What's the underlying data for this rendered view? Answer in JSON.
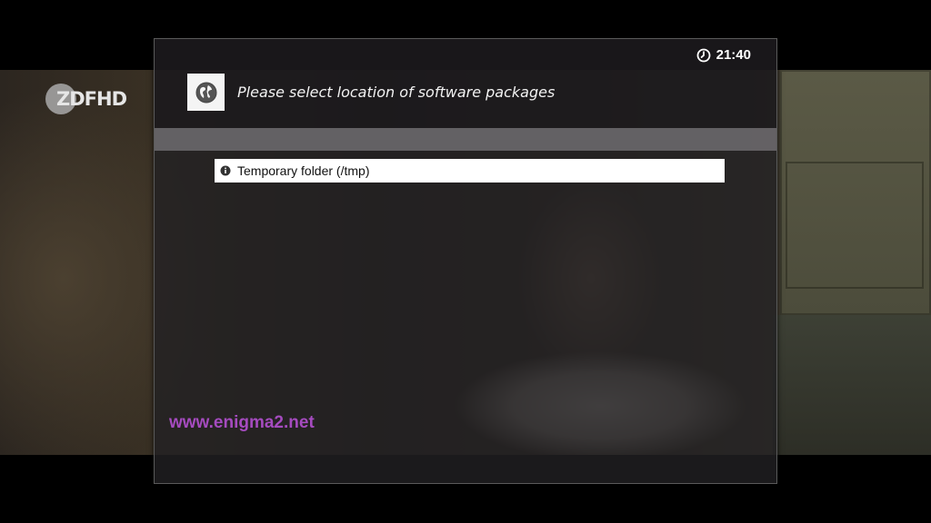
{
  "channel_logo": {
    "text": "ZDFHD"
  },
  "clock": {
    "time": "21:40"
  },
  "dialog": {
    "title": "Please select location of software packages",
    "app_icon": "globe-icon",
    "list": {
      "items": [
        {
          "label": "Temporary folder (/tmp)",
          "icon": "info-bullet-icon",
          "selected": true
        }
      ]
    },
    "footer_url": "www.enigma2.net"
  },
  "colors": {
    "selection_bg": "#ffffff",
    "url_color": "#a54bbf",
    "dialog_bg": "#222023"
  }
}
